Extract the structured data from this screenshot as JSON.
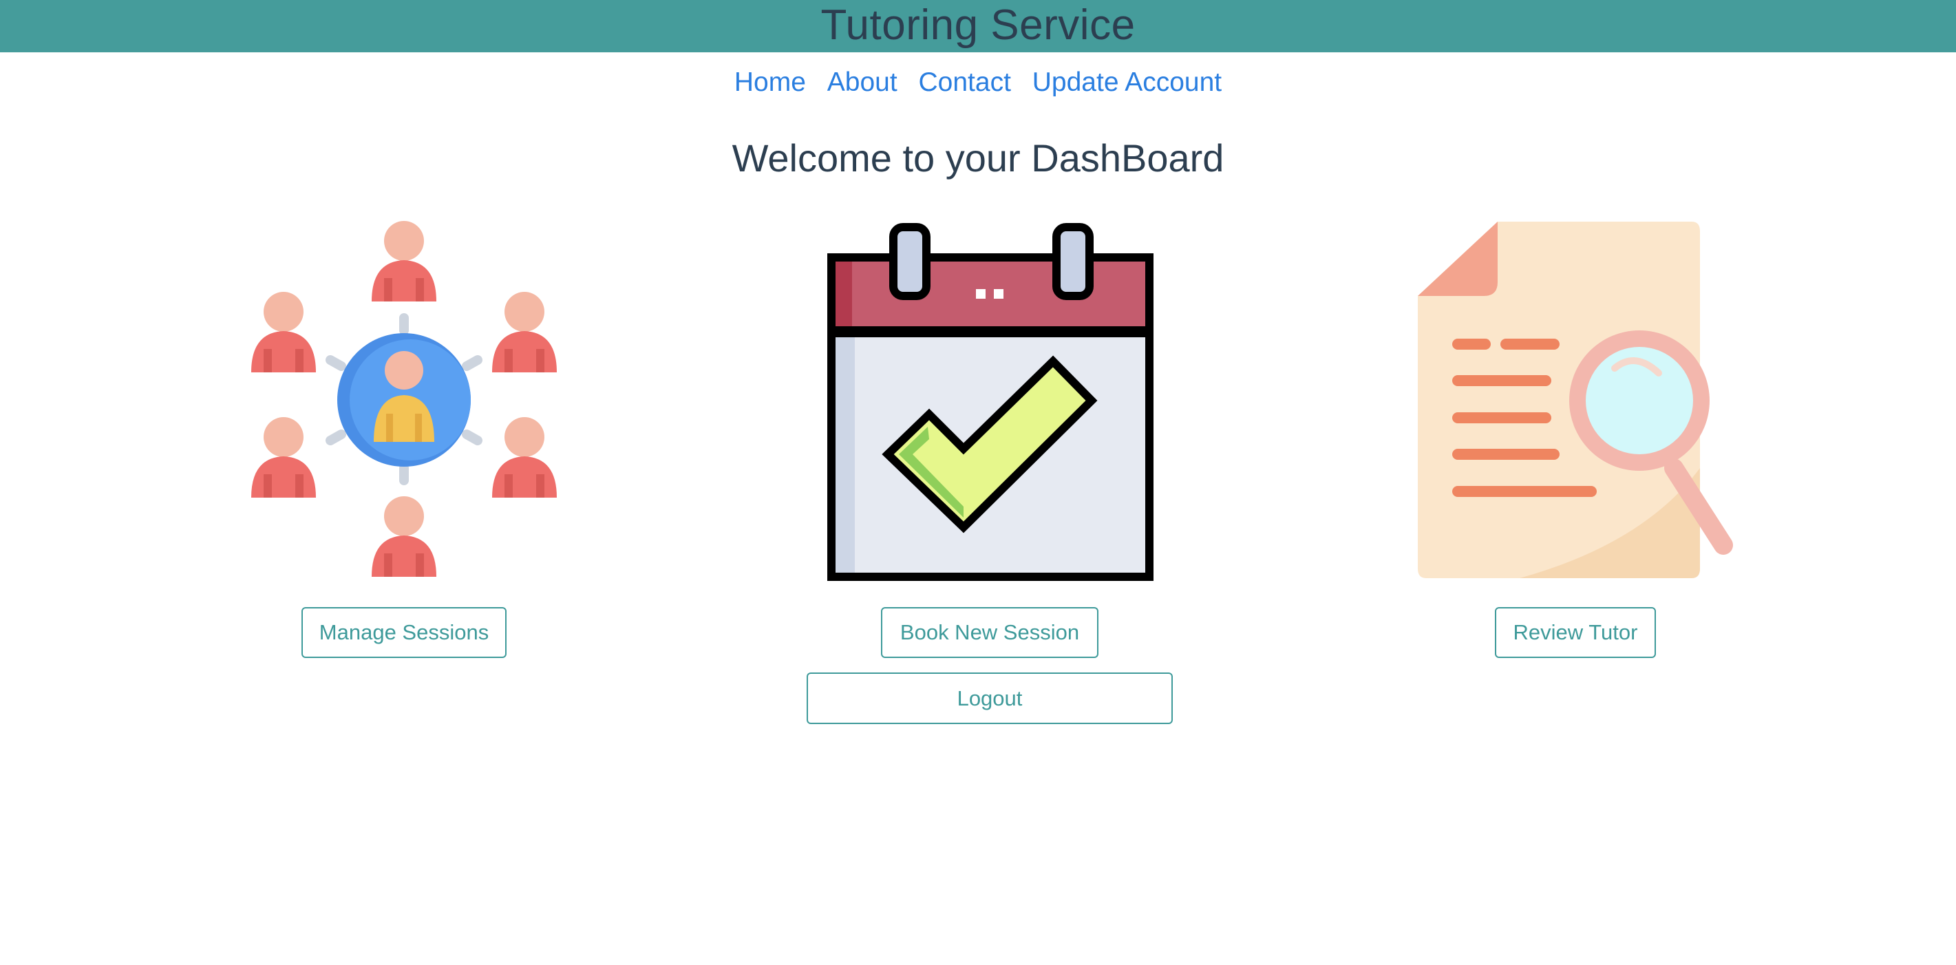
{
  "header": {
    "title": "Tutoring Service"
  },
  "nav": {
    "links": [
      {
        "label": "Home"
      },
      {
        "label": "About"
      },
      {
        "label": "Contact"
      },
      {
        "label": "Update Account"
      }
    ]
  },
  "main": {
    "heading": "Welcome to your DashBoard",
    "cards": [
      {
        "icon": "people-network-icon",
        "button_label": "Manage Sessions"
      },
      {
        "icon": "calendar-check-icon",
        "button_label": "Book New Session"
      },
      {
        "icon": "document-search-icon",
        "button_label": "Review Tutor"
      }
    ],
    "logout_label": "Logout"
  },
  "colors": {
    "header_bg": "#459c9b",
    "link": "#2a7ee0",
    "button_accent": "#3e9a9a",
    "text_dark": "#2c3e50"
  }
}
